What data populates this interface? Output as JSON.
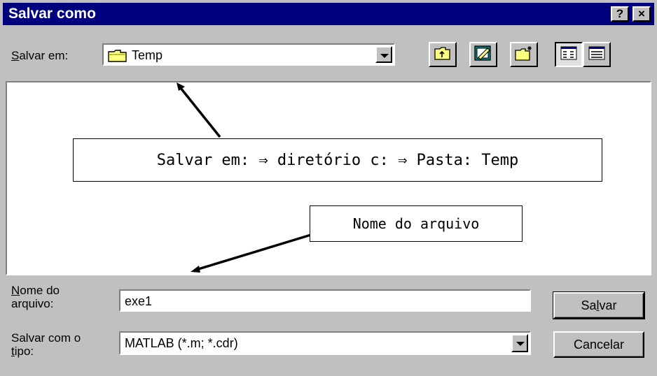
{
  "window": {
    "title": "Salvar como",
    "help_button": "?",
    "close_button": "×"
  },
  "location": {
    "label_prefix": "",
    "label_underline": "S",
    "label_rest": "alvar em:",
    "current_folder": "Temp"
  },
  "toolbar": {
    "icons": [
      "up-one-level-icon",
      "desktop-icon",
      "new-folder-icon",
      "list-view-icon",
      "details-view-icon"
    ]
  },
  "callouts": {
    "location_note": "Salvar em: ⇒ diretório c: ⇒ Pasta: Temp",
    "filename_note": "Nome do arquivo"
  },
  "filename": {
    "label_underline": "N",
    "label_line1_rest": "ome do",
    "label_line2": "arquivo:",
    "value": "exe1"
  },
  "filetype": {
    "label_line1": "Salvar com o",
    "label_underline": "t",
    "label_line2_rest": "ipo:",
    "value": "MATLAB (*.m; *.cdr)"
  },
  "buttons": {
    "save_prefix": "Sa",
    "save_underline": "l",
    "save_suffix": "var",
    "cancel": "Cancelar"
  },
  "colors": {
    "titlebar": "#00007f",
    "face": "#c0c0c0"
  }
}
